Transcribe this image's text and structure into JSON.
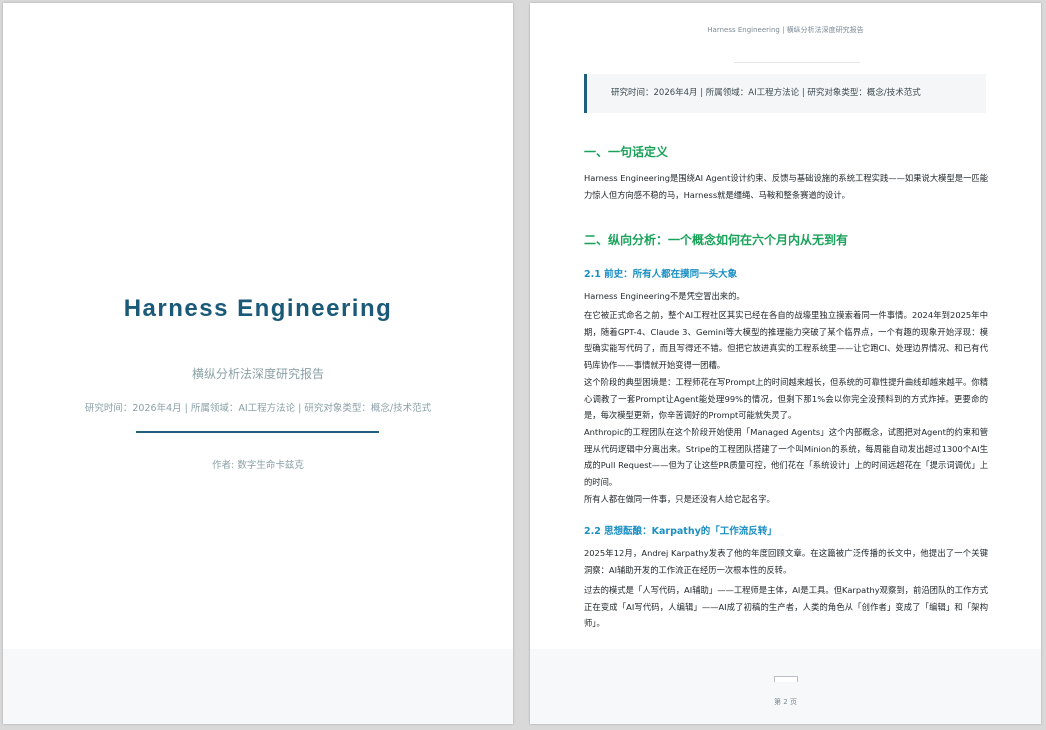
{
  "cover": {
    "title": "Harness Engineering",
    "subtitle": "横纵分析法深度研究报告",
    "meta": "研究时间：2026年4月 | 所属领域：AI工程方法论 | 研究对象类型：概念/技术范式",
    "author": "作者: 数字生命卡兹克"
  },
  "page2": {
    "running_head": "Harness Engineering | 横纵分析法深度研究报告",
    "meta_box": "研究时间：2026年4月 | 所属领域：AI工程方法论 | 研究对象类型：概念/技术范式",
    "section1": {
      "heading": "一、一句话定义",
      "text": "Harness Engineering是围绕AI Agent设计约束、反馈与基础设施的系统工程实践——如果说大模型是一匹能力惊人但方向感不稳的马，Harness就是缰绳、马鞍和整条赛道的设计。"
    },
    "section2": {
      "heading": "二、纵向分析：一个概念如何在六个月内从无到有",
      "sub1": {
        "heading": "2.1 前史：所有人都在摸同一头大象",
        "paragraphs": [
          "Harness Engineering不是凭空冒出来的。",
          "在它被正式命名之前，整个AI工程社区其实已经在各自的战壕里独立摸索着同一件事情。2024年到2025年中期，随着GPT-4、Claude 3、Gemini等大模型的推理能力突破了某个临界点，一个有趣的现象开始浮现：模型确实能写代码了，而且写得还不错。但把它放进真实的工程系统里——让它跑CI、处理边界情况、和已有代码库协作——事情就开始变得一团糟。",
          "这个阶段的典型困境是：工程师花在写Prompt上的时间越来越长，但系统的可靠性提升曲线却越来越平。你精心调教了一套Prompt让Agent能处理99%的情况，但剩下那1%会以你完全没预料到的方式炸掉。更要命的是，每次模型更新，你辛苦调好的Prompt可能就失灵了。",
          "Anthropic的工程团队在这个阶段开始使用「Managed Agents」这个内部概念，试图把对Agent的约束和管理从代码逻辑中分离出来。Stripe的工程团队搭建了一个叫Minion的系统，每周能自动发出超过1300个AI生成的Pull Request——但为了让这些PR质量可控，他们花在「系统设计」上的时间远超花在「提示词调优」上的时间。",
          "所有人都在做同一件事，只是还没有人给它起名字。"
        ]
      },
      "sub2": {
        "heading": "2.2 思想酝酿：Karpathy的「工作流反转」",
        "paragraphs": [
          "2025年12月，Andrej Karpathy发表了他的年度回顾文章。在这篇被广泛传播的长文中，他提出了一个关键洞察：AI辅助开发的工作流正在经历一次根本性的反转。",
          "过去的模式是「人写代码，AI辅助」——工程师是主体，AI是工具。但Karpathy观察到，前沿团队的工作方式正在变成「AI写代码，人编辑」——AI成了初稿的生产者，人类的角色从「创作者」变成了「编辑」和「架构师」。"
        ]
      }
    },
    "page_number": "第 2 页"
  }
}
